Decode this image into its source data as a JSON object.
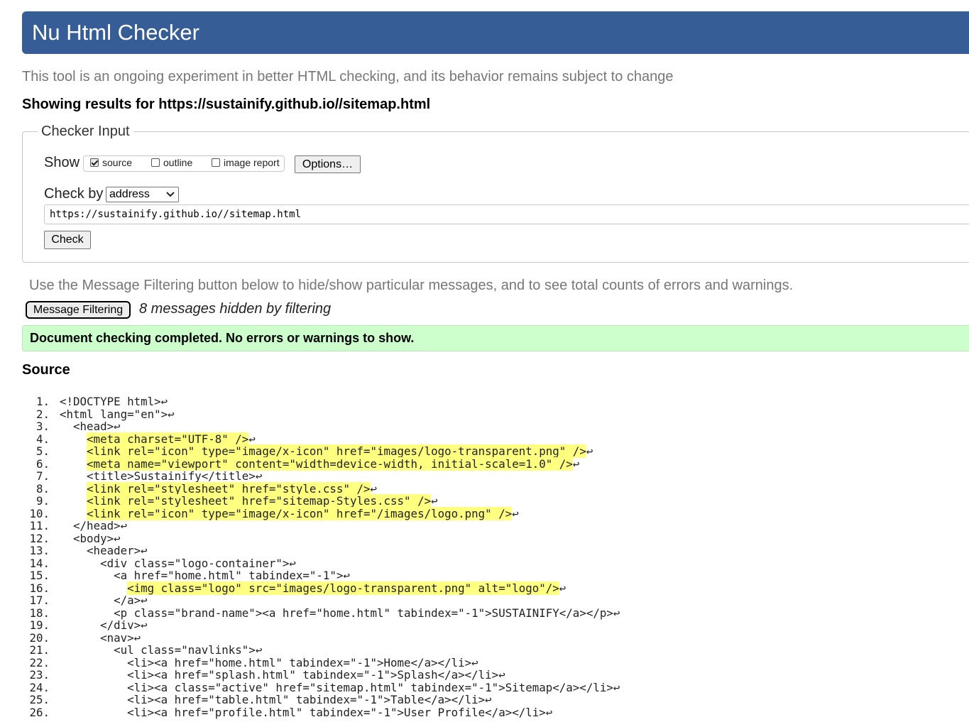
{
  "app": {
    "title": "Nu Html Checker",
    "tagline": "This tool is an ongoing experiment in better HTML checking, and its behavior remains subject to change"
  },
  "results": {
    "showing": "Showing results for https://sustainify.github.io//sitemap.html"
  },
  "checker_input": {
    "legend": "Checker Input",
    "show_label": "Show",
    "show_options": [
      {
        "label": "source",
        "checked": true
      },
      {
        "label": "outline",
        "checked": false
      },
      {
        "label": "image report",
        "checked": false
      }
    ],
    "options_button": "Options…",
    "check_by_label": "Check by",
    "check_by_value": "address",
    "url_value": "https://sustainify.github.io//sitemap.html",
    "check_button": "Check"
  },
  "filtering": {
    "hint": "Use the Message Filtering button below to hide/show particular messages, and to see total counts of errors and warnings.",
    "button": "Message Filtering",
    "hidden_count": "8 messages hidden by filtering"
  },
  "status": {
    "message": "Document checking completed. No errors or warnings to show.",
    "color": "#ccffcc"
  },
  "source": {
    "heading": "Source",
    "return_glyph": "↩",
    "highlight_color": "#ffff80",
    "lines": [
      {
        "n": "1.",
        "indent": "",
        "text": "<!DOCTYPE html>",
        "hl": false
      },
      {
        "n": "2.",
        "indent": "",
        "text": "<html lang=\"en\">",
        "hl": false
      },
      {
        "n": "3.",
        "indent": "  ",
        "text": "<head>",
        "hl": false
      },
      {
        "n": "4.",
        "indent": "    ",
        "text": "<meta charset=\"UTF-8\" />",
        "hl": true
      },
      {
        "n": "5.",
        "indent": "    ",
        "text": "<link rel=\"icon\" type=\"image/x-icon\" href=\"images/logo-transparent.png\" />",
        "hl": true
      },
      {
        "n": "6.",
        "indent": "    ",
        "text": "<meta name=\"viewport\" content=\"width=device-width, initial-scale=1.0\" />",
        "hl": true
      },
      {
        "n": "7.",
        "indent": "    ",
        "text": "<title>Sustainify</title>",
        "hl": false
      },
      {
        "n": "8.",
        "indent": "    ",
        "text": "<link rel=\"stylesheet\" href=\"style.css\" />",
        "hl": true
      },
      {
        "n": "9.",
        "indent": "    ",
        "text": "<link rel=\"stylesheet\" href=\"sitemap-Styles.css\" />",
        "hl": true
      },
      {
        "n": "10.",
        "indent": "    ",
        "text": "<link rel=\"icon\" type=\"image/x-icon\" href=\"/images/logo.png\" />",
        "hl": true
      },
      {
        "n": "11.",
        "indent": "  ",
        "text": "</head>",
        "hl": false
      },
      {
        "n": "12.",
        "indent": "  ",
        "text": "<body>",
        "hl": false
      },
      {
        "n": "13.",
        "indent": "    ",
        "text": "<header>",
        "hl": false
      },
      {
        "n": "14.",
        "indent": "      ",
        "text": "<div class=\"logo-container\">",
        "hl": false
      },
      {
        "n": "15.",
        "indent": "        ",
        "text": "<a href=\"home.html\" tabindex=\"-1\">",
        "hl": false
      },
      {
        "n": "16.",
        "indent": "          ",
        "text": "<img class=\"logo\" src=\"images/logo-transparent.png\" alt=\"logo\"/>",
        "hl": true
      },
      {
        "n": "17.",
        "indent": "        ",
        "text": "</a>",
        "hl": false
      },
      {
        "n": "18.",
        "indent": "        ",
        "text": "<p class=\"brand-name\"><a href=\"home.html\" tabindex=\"-1\">SUSTAINIFY</a></p>",
        "hl": false
      },
      {
        "n": "19.",
        "indent": "      ",
        "text": "</div>",
        "hl": false
      },
      {
        "n": "20.",
        "indent": "      ",
        "text": "<nav>",
        "hl": false
      },
      {
        "n": "21.",
        "indent": "        ",
        "text": "<ul class=\"navlinks\">",
        "hl": false
      },
      {
        "n": "22.",
        "indent": "          ",
        "text": "<li><a href=\"home.html\" tabindex=\"-1\">Home</a></li>",
        "hl": false
      },
      {
        "n": "23.",
        "indent": "          ",
        "text": "<li><a href=\"splash.html\" tabindex=\"-1\">Splash</a></li>",
        "hl": false
      },
      {
        "n": "24.",
        "indent": "          ",
        "text": "<li><a class=\"active\" href=\"sitemap.html\" tabindex=\"-1\">Sitemap</a></li>",
        "hl": false
      },
      {
        "n": "25.",
        "indent": "          ",
        "text": "<li><a href=\"table.html\" tabindex=\"-1\">Table</a></li>",
        "hl": false
      },
      {
        "n": "26.",
        "indent": "          ",
        "text": "<li><a href=\"profile.html\" tabindex=\"-1\">User Profile</a></li>",
        "hl": false
      }
    ]
  }
}
